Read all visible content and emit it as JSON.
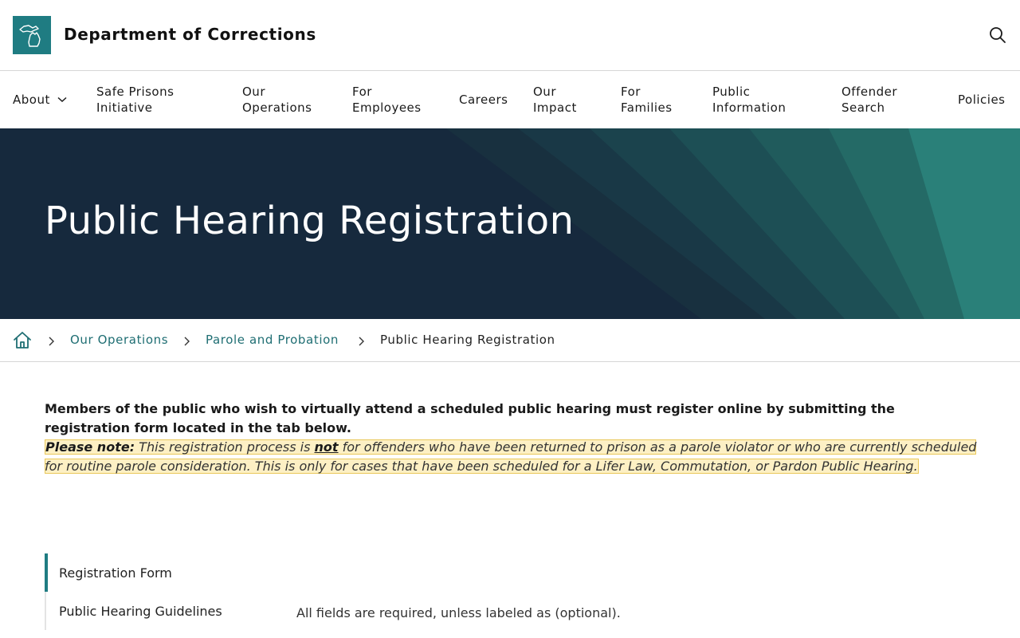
{
  "header": {
    "site_title": "Department of Corrections",
    "logo_icon": "michigan-map-icon",
    "search_icon": "search-icon",
    "brand_color": "#1f7c82"
  },
  "nav": {
    "items": [
      {
        "label": "About",
        "has_dropdown": true
      },
      {
        "label": "Safe Prisons\nInitiative"
      },
      {
        "label": "Our\nOperations"
      },
      {
        "label": "For\nEmployees"
      },
      {
        "label": "Careers"
      },
      {
        "label": "Our\nImpact"
      },
      {
        "label": "For\nFamilies"
      },
      {
        "label": "Public\nInformation"
      },
      {
        "label": "Offender\nSearch"
      },
      {
        "label": "Policies"
      }
    ]
  },
  "hero": {
    "title": "Public Hearing Registration",
    "bg_color": "#16293d",
    "accent_color": "#2a8079"
  },
  "breadcrumb": {
    "home_icon": "home-icon",
    "links": [
      "Our Operations",
      "Parole and Probation"
    ],
    "current": "Public Hearing Registration"
  },
  "content": {
    "intro": "Members of the public who wish to virtually attend a scheduled public hearing must register online by submitting the registration form located in the tab below.",
    "note_label": "Please note:",
    "note_before": " This registration process is ",
    "note_emphasis": "not",
    "note_after": " for offenders who have been returned to prison as a parole violator or who are currently scheduled for routine parole consideration. This is only for cases that have been scheduled for a Lifer Law, Commutation, or Pardon Public Hearing."
  },
  "tabs": {
    "items": [
      {
        "label": "Registration Form",
        "active": true
      },
      {
        "label": "Public Hearing Guidelines",
        "active": false
      }
    ]
  },
  "form": {
    "fields_note": "All fields are required, unless labeled as (optional)."
  }
}
